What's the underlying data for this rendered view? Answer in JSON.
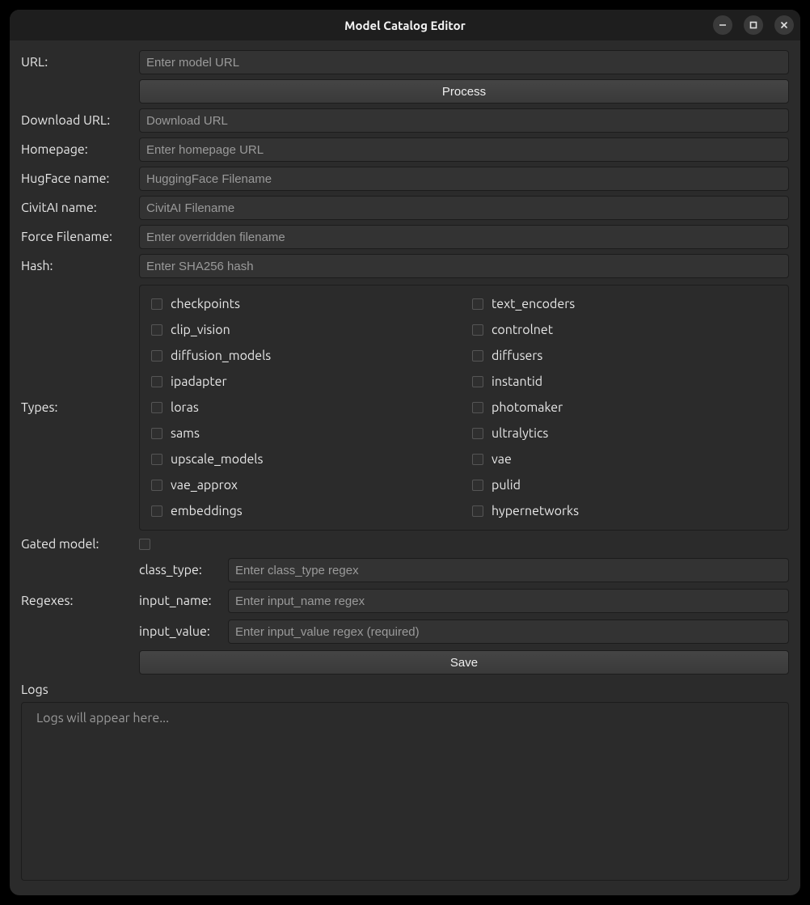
{
  "window": {
    "title": "Model Catalog Editor"
  },
  "fields": {
    "url_label": "URL:",
    "url_placeholder": "Enter model URL",
    "process_label": "Process",
    "download_url_label": "Download URL:",
    "download_url_placeholder": "Download URL",
    "homepage_label": "Homepage:",
    "homepage_placeholder": "Enter homepage URL",
    "hugface_label": "HugFace name:",
    "hugface_placeholder": "HuggingFace Filename",
    "civitai_label": "CivitAI name:",
    "civitai_placeholder": "CivitAI Filename",
    "force_filename_label": "Force Filename:",
    "force_filename_placeholder": "Enter overridden filename",
    "hash_label": "Hash:",
    "hash_placeholder": "Enter SHA256 hash",
    "types_label": "Types:",
    "gated_label": "Gated model:",
    "regexes_label": "Regexes:",
    "save_label": "Save",
    "logs_label": "Logs",
    "logs_placeholder": "Logs will appear here..."
  },
  "types": {
    "col1": [
      "checkpoints",
      "clip_vision",
      "diffusion_models",
      "ipadapter",
      "loras",
      "sams",
      "upscale_models",
      "vae_approx",
      "embeddings"
    ],
    "col2": [
      "text_encoders",
      "controlnet",
      "diffusers",
      "instantid",
      "photomaker",
      "ultralytics",
      "vae",
      "pulid",
      "hypernetworks"
    ]
  },
  "regexes": {
    "class_type_label": "class_type:",
    "class_type_placeholder": "Enter class_type regex",
    "input_name_label": "input_name:",
    "input_name_placeholder": "Enter input_name regex",
    "input_value_label": "input_value:",
    "input_value_placeholder": "Enter input_value regex (required)"
  }
}
